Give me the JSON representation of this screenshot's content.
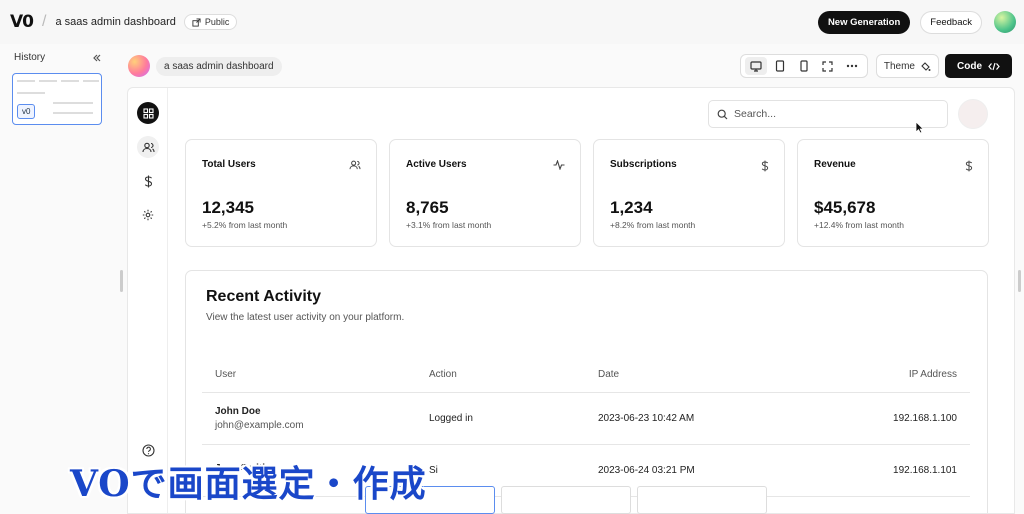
{
  "topbar": {
    "logo": "V0",
    "separator": "/",
    "project_title": "a saas admin dashboard",
    "visibility": "Public",
    "new_generation": "New Generation",
    "feedback": "Feedback"
  },
  "history": {
    "title": "History",
    "collapse_icon": "chevrons-left-icon",
    "version_label": "v0"
  },
  "preview": {
    "chip_label": "a saas admin dashboard",
    "device_icons": [
      "desktop-icon",
      "tablet-icon",
      "mobile-icon",
      "fullscreen-icon",
      "more-icon"
    ],
    "theme_label": "Theme",
    "code_label": "Code"
  },
  "dashboard": {
    "search_placeholder": "Search...",
    "nav_icons": [
      "grid-icon",
      "users-icon",
      "dollar-icon",
      "settings-icon",
      "help-icon"
    ],
    "cards": [
      {
        "title": "Total Users",
        "value": "12,345",
        "change": "+5.2% from last month",
        "icon": "users-icon"
      },
      {
        "title": "Active Users",
        "value": "8,765",
        "change": "+3.1% from last month",
        "icon": "activity-icon"
      },
      {
        "title": "Subscriptions",
        "value": "1,234",
        "change": "+8.2% from last month",
        "icon": "dollar-icon"
      },
      {
        "title": "Revenue",
        "value": "$45,678",
        "change": "+12.4% from last month",
        "icon": "dollar-icon"
      }
    ],
    "activity": {
      "title": "Recent Activity",
      "subtitle": "View the latest user activity on your platform.",
      "columns": [
        "User",
        "Action",
        "Date",
        "IP Address"
      ],
      "rows": [
        {
          "name": "John Doe",
          "email": "john@example.com",
          "action": "Logged in",
          "date": "2023-06-23 10:42 AM",
          "ip": "192.168.1.100"
        },
        {
          "name": "Jane Smith",
          "email": "",
          "action": "Si",
          "date": "2023-06-24 03:21 PM",
          "ip": "192.168.1.101"
        }
      ]
    }
  },
  "caption": "VOで画面選定・作成",
  "colors": {
    "accent": "#111111",
    "caption": "#1a47c9",
    "selection": "#5b8def"
  }
}
